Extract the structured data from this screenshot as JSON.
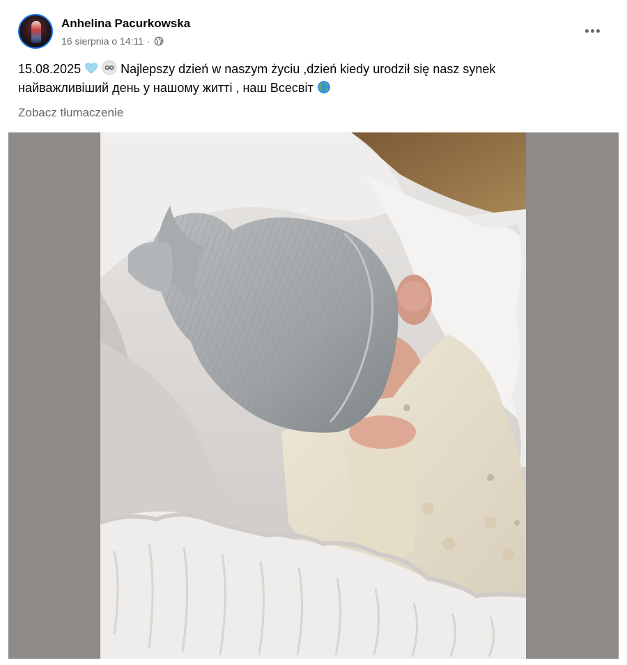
{
  "post": {
    "author": "Anhelina Pacurkowska",
    "timestamp": "16 sierpnia o 14:11",
    "separator": "·",
    "audience_icon": "globe-icon",
    "more_icon": "more-horizontal-icon",
    "text_line1_date": "15.08.2025",
    "text_line1_rest": " Najlepszy  dzień w naszym życiu ,dzień kiedy urodził się nasz synek",
    "text_line2": "найважливіший день у нашому житті , наш Всесвіт",
    "emojis": [
      "light-blue-heart-icon",
      "infinity-icon",
      "globe-earth-icon"
    ],
    "see_translation": "Zobacz tłumaczenie"
  },
  "colors": {
    "text": "#050505",
    "secondary": "#65676b",
    "avatar_ring": "#1877f2",
    "media_background": "#8e8a88"
  }
}
